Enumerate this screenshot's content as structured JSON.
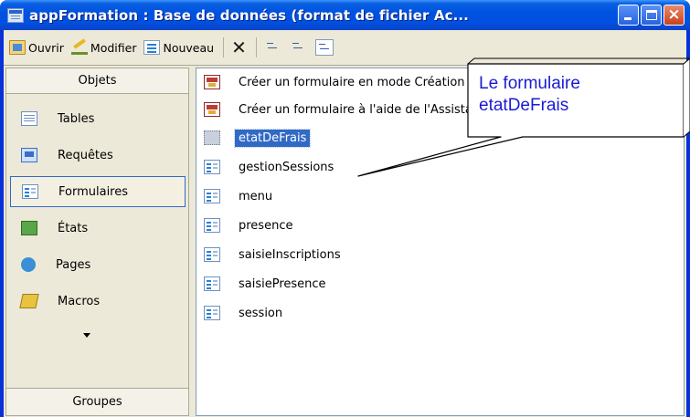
{
  "window": {
    "title": "appFormation : Base de données (format de fichier Ac...",
    "buttons": {
      "minimize": "minimize",
      "maximize": "maximize",
      "close": "×"
    }
  },
  "toolbar": {
    "open_label": "Ouvrir",
    "modify_label": "Modifier",
    "new_label": "Nouveau",
    "delete_icon": "✕"
  },
  "objects": {
    "header": "Objets",
    "items": [
      {
        "label": "Tables",
        "icon": "table-icon"
      },
      {
        "label": "Requêtes",
        "icon": "query-icon"
      },
      {
        "label": "Formulaires",
        "icon": "form-icon",
        "selected": true
      },
      {
        "label": "États",
        "icon": "report-icon"
      },
      {
        "label": "Pages",
        "icon": "page-icon"
      },
      {
        "label": "Macros",
        "icon": "macro-icon"
      }
    ],
    "groups_label": "Groupes"
  },
  "list": {
    "items": [
      {
        "label": "Créer un formulaire en mode Création",
        "icon": "create-form-icon"
      },
      {
        "label": "Créer un formulaire à l'aide de l'Assistant",
        "icon": "create-form-icon"
      },
      {
        "label": "etatDeFrais",
        "icon": "form-icon",
        "selected": true
      },
      {
        "label": "gestionSessions",
        "icon": "form-icon"
      },
      {
        "label": "menu",
        "icon": "form-icon"
      },
      {
        "label": "presence",
        "icon": "form-icon"
      },
      {
        "label": "saisieInscriptions",
        "icon": "form-icon"
      },
      {
        "label": "saisiePresence",
        "icon": "form-icon"
      },
      {
        "label": "session",
        "icon": "form-icon"
      }
    ]
  },
  "callout": {
    "line1": "Le formulaire",
    "line2": "etatDeFrais"
  },
  "colors": {
    "titlebar": "#0053e1",
    "selection": "#316ac5",
    "callout_text": "#1a1ad6"
  }
}
